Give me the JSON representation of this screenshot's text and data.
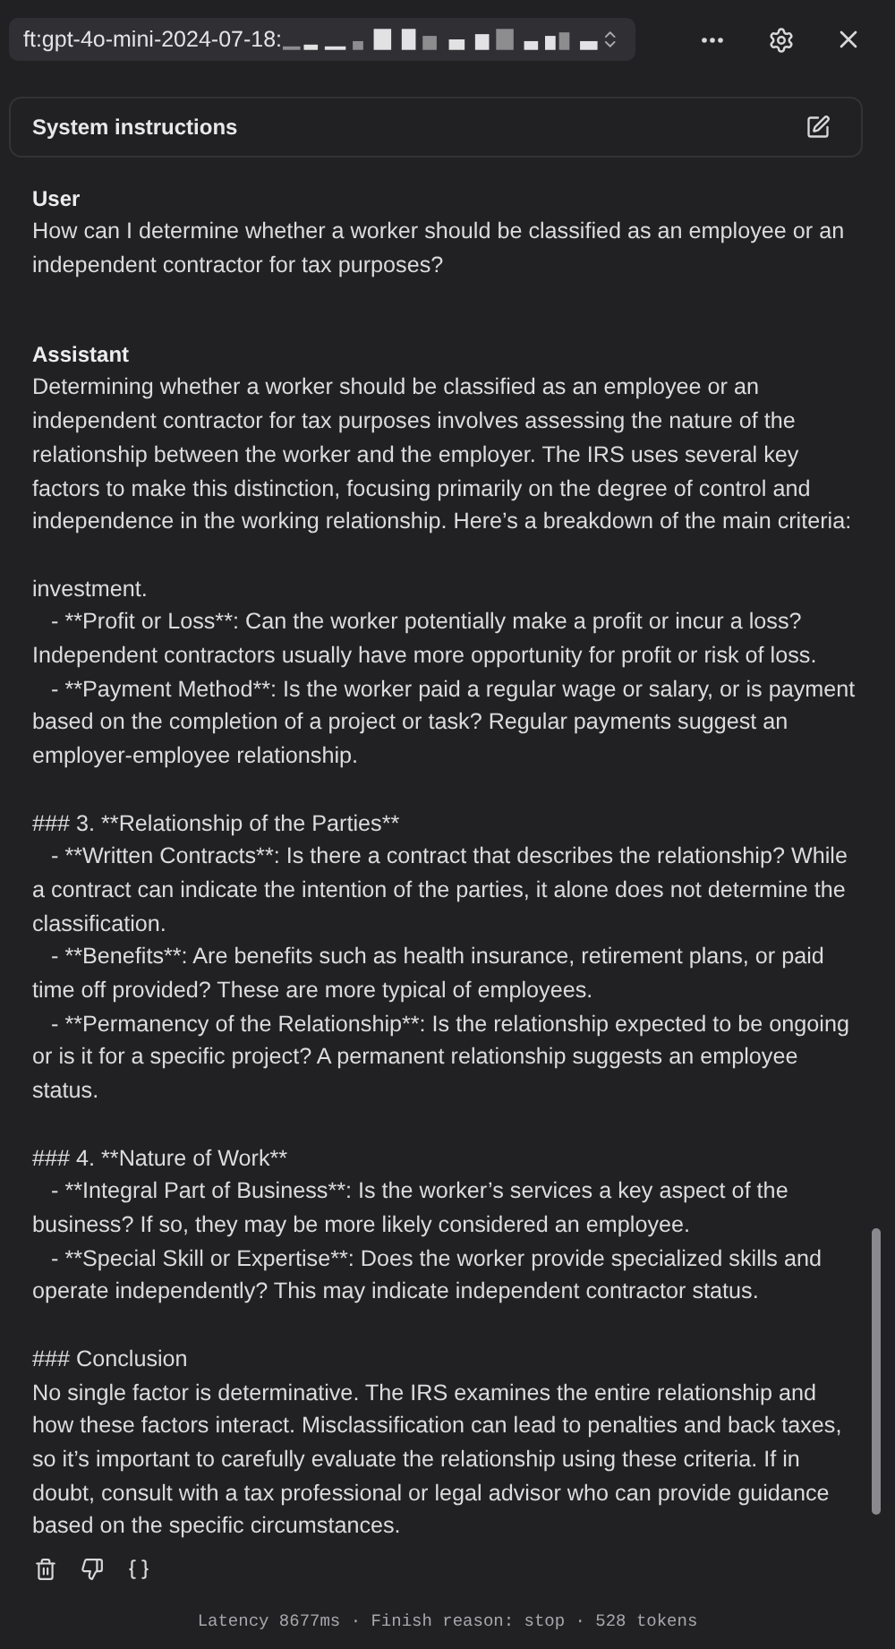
{
  "header": {
    "model": "ft:gpt-4o-mini-2024-07-18:"
  },
  "system_instructions": {
    "label": "System instructions"
  },
  "messages": [
    {
      "role": "User",
      "text": "How can I determine whether a worker should be classified as an employee or an independent contractor for tax purposes?"
    },
    {
      "role": "Assistant",
      "text": "Determining whether a worker should be classified as an employee or an independent contractor for tax purposes involves assessing the nature of the relationship between the worker and the employer. The IRS uses several key factors to make this distinction, focusing primarily on the degree of control and independence in the working relationship. Here’s a breakdown of the main criteria:\n\ninvestment.\n   - **Profit or Loss**: Can the worker potentially make a profit or incur a loss? Independent contractors usually have more opportunity for profit or risk of loss.\n   - **Payment Method**: Is the worker paid a regular wage or salary, or is payment based on the completion of a project or task? Regular payments suggest an employer-employee relationship.\n\n### 3. **Relationship of the Parties**\n   - **Written Contracts**: Is there a contract that describes the relationship? While a contract can indicate the intention of the parties, it alone does not determine the classification.\n   - **Benefits**: Are benefits such as health insurance, retirement plans, or paid time off provided? These are more typical of employees.\n   - **Permanency of the Relationship**: Is the relationship expected to be ongoing or is it for a specific project? A permanent relationship suggests an employee status.\n\n### 4. **Nature of Work**\n   - **Integral Part of Business**: Is the worker’s services a key aspect of the business? If so, they may be more likely considered an employee.\n   - **Special Skill or Expertise**: Does the worker provide specialized skills and operate independently? This may indicate independent contractor status.\n\n### Conclusion\nNo single factor is determinative. The IRS examines the entire relationship and how these factors interact. Misclassification can lead to penalties and back taxes, so it’s important to carefully evaluate the relationship using these criteria. If in doubt, consult with a tax professional or legal advisor who can provide guidance based on the specific circumstances."
    }
  ],
  "footer": {
    "status": "Latency 8677ms · Finish reason: stop · 528 tokens"
  }
}
